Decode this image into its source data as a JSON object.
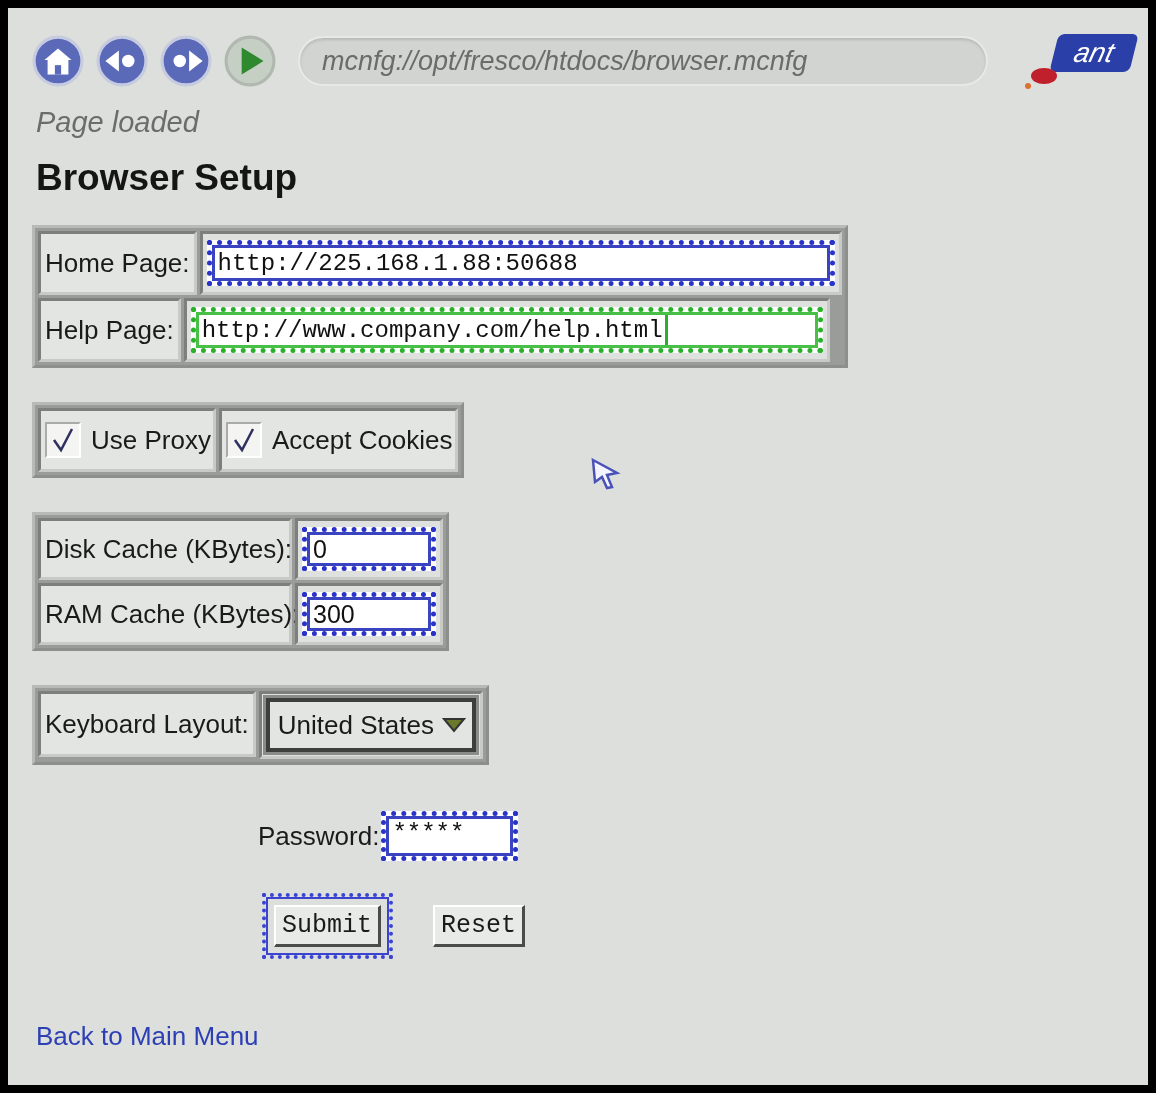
{
  "toolbar": {
    "buttons": [
      {
        "kind": "home"
      },
      {
        "kind": "back"
      },
      {
        "kind": "forward"
      },
      {
        "kind": "go"
      }
    ],
    "address": "mcnfg://opt/fresco/htdocs/browser.mcnfg",
    "logo": "ant"
  },
  "status": "Page loaded",
  "heading": "Browser Setup",
  "url_fields": [
    {
      "label": "Home Page:",
      "value": "http://225.168.1.88:50688",
      "focused": false
    },
    {
      "label": "Help Page:",
      "value": "http://www.company.com/help.html",
      "focused": true
    }
  ],
  "checkboxes": [
    {
      "label": "Use Proxy",
      "checked": true
    },
    {
      "label": "Accept Cookies",
      "checked": true
    }
  ],
  "cache_fields": [
    {
      "label": "Disk Cache (KBytes):",
      "value": "0"
    },
    {
      "label": "RAM Cache (KBytes):",
      "value": "300"
    }
  ],
  "keyboard_layout": {
    "label": "Keyboard Layout:",
    "value": "United States"
  },
  "password": {
    "label": "Password:",
    "value": "*****"
  },
  "buttons": [
    {
      "label": "Submit",
      "selected": true
    },
    {
      "label": "Reset",
      "selected": false
    }
  ],
  "link": "Back to Main Menu"
}
